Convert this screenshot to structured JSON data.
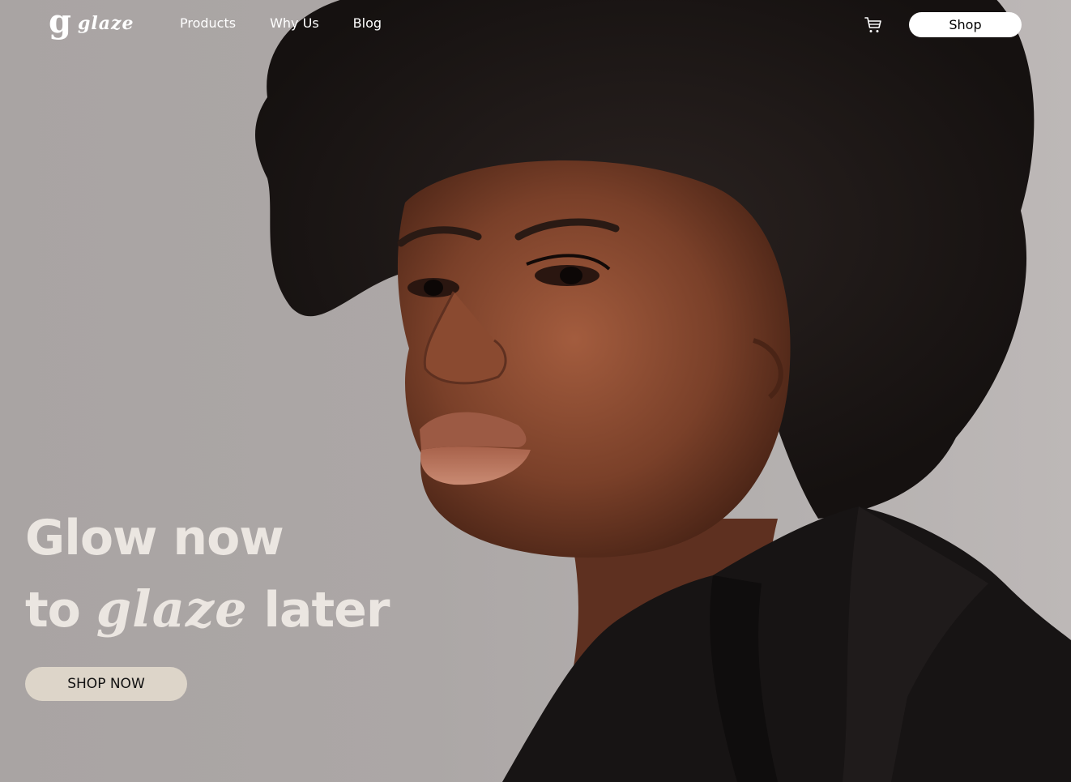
{
  "brand": {
    "logo_mark": "g",
    "logo_word": "glaze"
  },
  "nav": {
    "links": [
      {
        "label": "Products"
      },
      {
        "label": "Why Us"
      },
      {
        "label": "Blog"
      }
    ],
    "cart_icon": "cart-icon",
    "shop_label": "Shop"
  },
  "hero": {
    "headline_line1": "Glow now",
    "headline_line2_start": "to ",
    "headline_brand": "glaze",
    "headline_line2_end": " later",
    "cta_label": "SHOP NOW",
    "image": "portrait-photo"
  },
  "colors": {
    "background": "#aca7a6",
    "headline": "#ebe6e1",
    "cta_background": "#ddd5c9",
    "shop_button": "#ffffff"
  }
}
